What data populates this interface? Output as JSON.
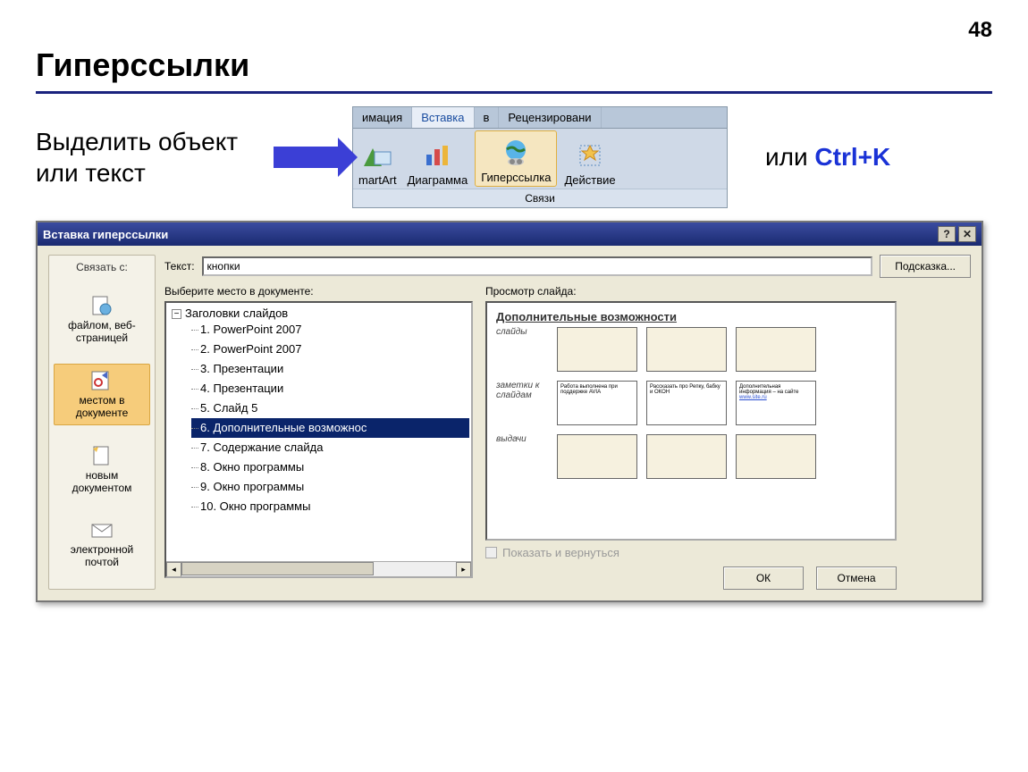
{
  "page_number": "48",
  "title": "Гиперссылки",
  "instruction": "Выделить объект или текст",
  "shortcut_prefix": "или ",
  "shortcut_key": "Ctrl+K",
  "ribbon": {
    "tabs": [
      "имация",
      "Вставка",
      "в",
      "Рецензировани"
    ],
    "active_tab_index": 1,
    "buttons": [
      {
        "label": "martArt"
      },
      {
        "label": "Диаграмма"
      },
      {
        "label": "Гиперссылка",
        "selected": true
      },
      {
        "label": "Действие"
      }
    ],
    "group_label": "Связи"
  },
  "dialog": {
    "title": "Вставка гиперссылки",
    "link_with_label": "Связать с:",
    "link_items": [
      {
        "label": "файлом, веб-страницей"
      },
      {
        "label": "местом в документе",
        "selected": true
      },
      {
        "label": "новым документом"
      },
      {
        "label": "электронной почтой"
      }
    ],
    "text_label": "Текст:",
    "text_value": "кнопки",
    "hint_button": "Подсказка...",
    "tree_label": "Выберите место в документе:",
    "tree_root": "Заголовки слайдов",
    "tree_children": [
      "1. PowerPoint 2007",
      "2. PowerPoint 2007",
      "3. Презентации",
      "4. Презентации",
      "5. Слайд 5",
      "6. Дополнительные возможнос",
      "7. Содержание слайда",
      "8. Окно программы",
      "9. Окно программы",
      "10. Окно программы"
    ],
    "selected_tree_index": 5,
    "preview_label": "Просмотр слайда:",
    "preview_slide_title": "Дополнительные возможности",
    "preview_sections": {
      "row1": "слайды",
      "row2": "заметки к слайдам",
      "row3": "выдачи",
      "card1": "Работа выполнена при поддержке AVIA",
      "card2": "Рассказать про Репку, бабку и ОКОН",
      "card3a": "Дополнительная информация – на сайте",
      "card3b": "www.site.ru"
    },
    "show_return": "Показать и вернуться",
    "ok": "ОК",
    "cancel": "Отмена"
  }
}
